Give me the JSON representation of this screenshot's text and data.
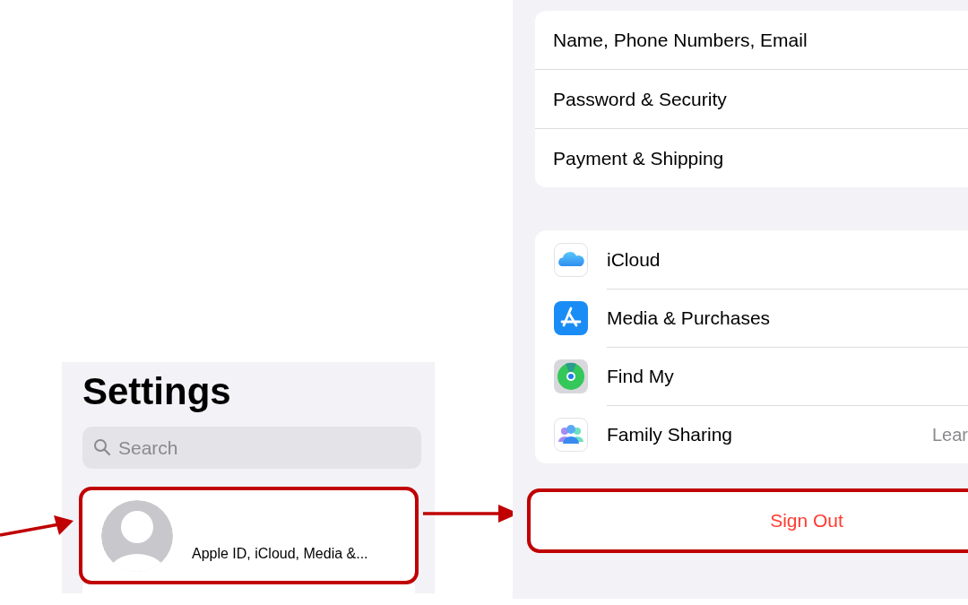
{
  "settings_panel": {
    "title": "Settings",
    "search": {
      "placeholder": "Search"
    },
    "profile": {
      "subtitle": "Apple ID, iCloud, Media &..."
    }
  },
  "apple_id_panel": {
    "account_items": [
      {
        "label": "Name, Phone Numbers, Email"
      },
      {
        "label": "Password & Security"
      },
      {
        "label": "Payment & Shipping"
      }
    ],
    "services": [
      {
        "label": "iCloud"
      },
      {
        "label": "Media & Purchases"
      },
      {
        "label": "Find My"
      },
      {
        "label": "Family Sharing",
        "detail": "Lear"
      }
    ],
    "sign_out": "Sign Out"
  }
}
